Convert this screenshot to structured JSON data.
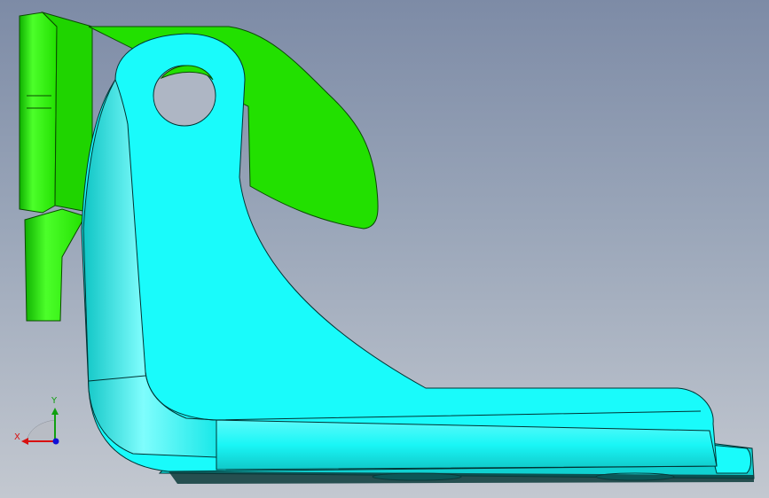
{
  "viewport": {
    "background_top": "#7d8ba6",
    "background_bottom": "#c3c8d0"
  },
  "model": {
    "parts": [
      {
        "name": "green-part",
        "color": "#22e000",
        "shade": "#15a800"
      },
      {
        "name": "cyan-bracket",
        "color": "#19fbfb",
        "shade": "#0fb6b6"
      }
    ]
  },
  "triad": {
    "x_label": "X",
    "y_label": "Y",
    "x_color": "#d81010",
    "y_color": "#10a010",
    "z_color": "#1010d8"
  }
}
